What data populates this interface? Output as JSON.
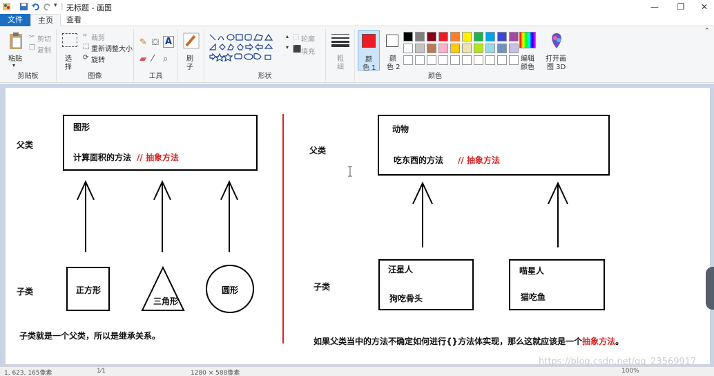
{
  "window": {
    "title": "无标题 - 画图",
    "min_glyph": "—",
    "restore_glyph": "❐",
    "close_glyph": "✕"
  },
  "tabs": {
    "file": "文件",
    "home": "主页",
    "view": "查看"
  },
  "ribbon": {
    "clipboard": {
      "label": "剪贴板",
      "paste": "粘贴",
      "cut": "剪切",
      "copy": "复制"
    },
    "image": {
      "label": "图像",
      "select": "选",
      "select2": "择",
      "crop": "裁剪",
      "resize": "重新调整大小",
      "rotate": "旋转"
    },
    "tools": {
      "label": "工具"
    },
    "brushes": {
      "label1": "刷",
      "label2": "子"
    },
    "shapes": {
      "label": "形状",
      "outline": "轮廓",
      "fill": "填充"
    },
    "size": {
      "label1": "粗",
      "label2": "细"
    },
    "colors": {
      "label": "颜色",
      "color1_a": "颜",
      "color1_b": "色 1",
      "color2_a": "颜",
      "color2_b": "色 2",
      "edit_a": "编辑",
      "edit_b": "颜色",
      "paint3d_a": "打开画",
      "paint3d_b": "图 3D",
      "color1_value": "#ed1c24",
      "color2_value": "#ffffff",
      "palette_row1": [
        "#000000",
        "#7f7f7f",
        "#880015",
        "#ed1c24",
        "#ff7f27",
        "#fff200",
        "#22b14c",
        "#00a2e8",
        "#3f48cc",
        "#a349a4"
      ],
      "palette_row2": [
        "#ffffff",
        "#c3c3c3",
        "#b97a57",
        "#ffaec9",
        "#ffc90e",
        "#efe4b0",
        "#b5e61d",
        "#99d9ea",
        "#7092be",
        "#c8bfe7"
      ]
    }
  },
  "canvas": {
    "left": {
      "parent_label": "父类",
      "child_label": "子类",
      "parent_box_title": "图形",
      "parent_box_method": "计算面积的方法",
      "parent_box_abstract": "// 抽象方法",
      "children": [
        "正方形",
        "三角形",
        "圆形"
      ],
      "caption": "子类就是一个父类，所以是继承关系。"
    },
    "right": {
      "parent_label": "父类",
      "child_label": "子类",
      "parent_box_title": "动物",
      "parent_box_method": "吃东西的方法",
      "parent_box_abstract": "// 抽象方法",
      "child1_title": "汪星人",
      "child1_method": "狗吃骨头",
      "child2_title": "喵星人",
      "child2_method": "猫吃鱼",
      "caption_main": "如果父类当中的方法不确定如何进行{}方法体实现，那么这就应该是一个",
      "caption_red": "抽象方法",
      "caption_end": "。"
    }
  },
  "status": {
    "pos": "1, 623, 165像素",
    "selection": "1⁄1",
    "size": "1280 × 588像素",
    "zoom": "100%"
  },
  "watermark": "https://blog.csdn.net/qq_23569917"
}
